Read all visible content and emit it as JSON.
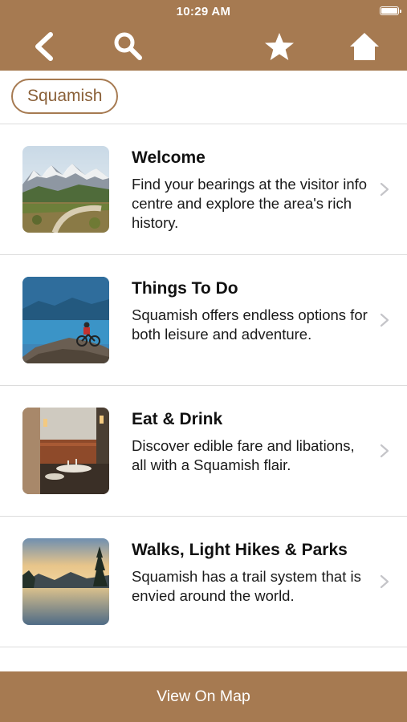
{
  "status_bar": {
    "time": "10:29 AM"
  },
  "nav": {
    "back_icon": "chevron-left-icon",
    "search_icon": "search-icon",
    "favorite_icon": "star-icon",
    "home_icon": "home-icon"
  },
  "location_chip": {
    "label": "Squamish"
  },
  "items": [
    {
      "title": "Welcome",
      "description": "Find your bearings at the visitor info centre and explore the area's rich history.",
      "image": "mountain-trail-photo"
    },
    {
      "title": "Things To Do",
      "description": "Squamish offers endless options for both leisure and adventure.",
      "image": "mountain-biker-photo"
    },
    {
      "title": "Eat & Drink",
      "description": "Discover edible fare and libations, all with a Squamish flair.",
      "image": "restaurant-interior-photo"
    },
    {
      "title": "Walks, Light Hikes & Parks",
      "description": "Squamish has a trail system that is envied around the world.",
      "image": "lake-sunset-photo"
    }
  ],
  "bottom_bar": {
    "label": "View On Map"
  },
  "colors": {
    "brand": "#a67a51",
    "chip_text": "#8a6038",
    "divider": "#dcdcdc"
  }
}
